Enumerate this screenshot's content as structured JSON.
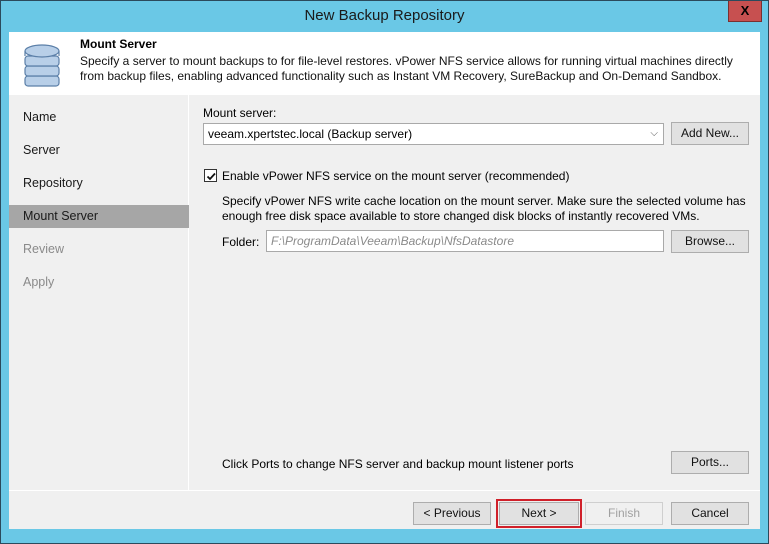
{
  "window": {
    "title": "New Backup Repository",
    "close_label": "X",
    "accent_color": "#6ac8e6"
  },
  "header": {
    "icon": "database-icon",
    "title": "Mount Server",
    "description": "Specify a server to mount backups to for file-level restores. vPower NFS service allows for running virtual machines directly from backup files, enabling advanced functionality such as Instant VM Recovery, SureBackup and On-Demand Sandbox."
  },
  "sidebar": {
    "items": [
      {
        "label": "Name",
        "state": "done"
      },
      {
        "label": "Server",
        "state": "done"
      },
      {
        "label": "Repository",
        "state": "done"
      },
      {
        "label": "Mount Server",
        "state": "active"
      },
      {
        "label": "Review",
        "state": "disabled"
      },
      {
        "label": "Apply",
        "state": "disabled"
      }
    ]
  },
  "main": {
    "mount_server_label": "Mount server:",
    "mount_server_value": "veeam.xpertstec.local (Backup server)",
    "add_new_label": "Add New...",
    "enable_nfs_label": "Enable vPower NFS service on the mount server (recommended)",
    "enable_nfs_checked": true,
    "nfs_description": "Specify vPower NFS write cache location on the mount server. Make sure the selected volume has enough free disk space available to store changed disk blocks of instantly recovered VMs.",
    "folder_label": "Folder:",
    "folder_value": "F:\\ProgramData\\Veeam\\Backup\\NfsDatastore",
    "browse_label": "Browse...",
    "ports_hint": "Click Ports to change NFS server and backup mount listener ports",
    "ports_label": "Ports..."
  },
  "footer": {
    "previous_label": "< Previous",
    "next_label": "Next >",
    "finish_label": "Finish",
    "cancel_label": "Cancel",
    "highlight_color": "#d0202a"
  }
}
